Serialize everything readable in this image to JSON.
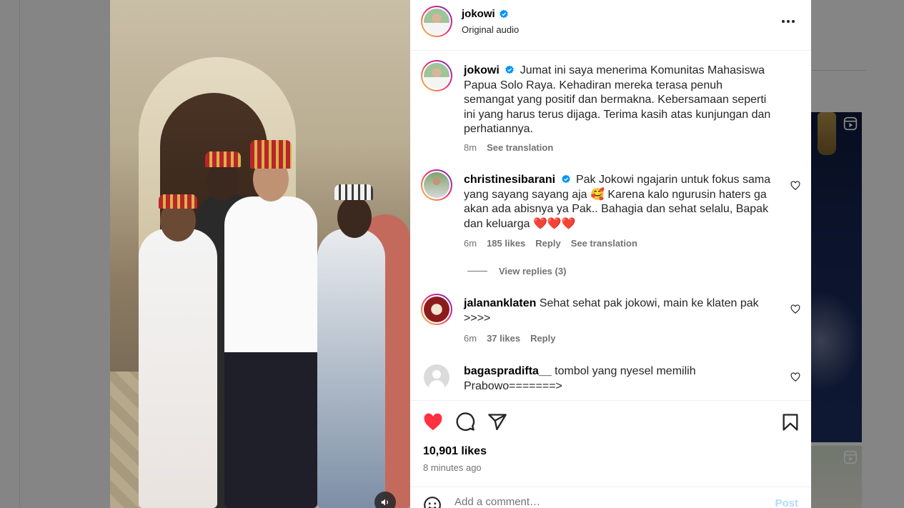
{
  "header": {
    "username": "jokowi",
    "subtitle": "Original audio"
  },
  "caption": {
    "username": "jokowi",
    "text": "Jumat ini saya menerima Komunitas Mahasiswa Papua Solo Raya. Kehadiran mereka terasa penuh semangat yang positif dan bermakna. Kebersamaan seperti ini yang harus terus dijaga. Terima kasih atas kunjungan dan perhatiannya.",
    "time": "8m",
    "translate": "See translation"
  },
  "comments": [
    {
      "username": "christinesibarani",
      "text": "Pak Jokowi ngajarin untuk fokus sama yang sayang sayang aja 🥰 Karena kalo ngurusin haters ga akan ada abisnya ya Pak.. Bahagia dan sehat selalu, Bapak dan keluarga ❤️❤️❤️",
      "time": "6m",
      "likes": "185 likes",
      "reply": "Reply",
      "translate": "See translation",
      "view_replies": "View replies (3)"
    },
    {
      "username": "jalananklaten",
      "text": "Sehat sehat pak jokowi, main ke klaten pak >>>>",
      "time": "6m",
      "likes": "37 likes",
      "reply": "Reply"
    },
    {
      "username": "bagaspradifta__",
      "text": "tombol yang nyesel memilih Prabowo=======>"
    }
  ],
  "footer": {
    "likes": "10,901 likes",
    "time_ago": "8 minutes ago",
    "comment_placeholder": "Add a comment…",
    "post_label": "Post"
  },
  "colors": {
    "verified": "#0095f6",
    "liked_heart": "#ff3040",
    "post_button": "#b3dbff"
  },
  "icons": [
    "verified-badge-icon",
    "more-options-icon",
    "heart-icon",
    "comment-icon",
    "share-icon",
    "bookmark-icon",
    "emoji-icon",
    "audio-muted-icon",
    "reels-icon"
  ]
}
